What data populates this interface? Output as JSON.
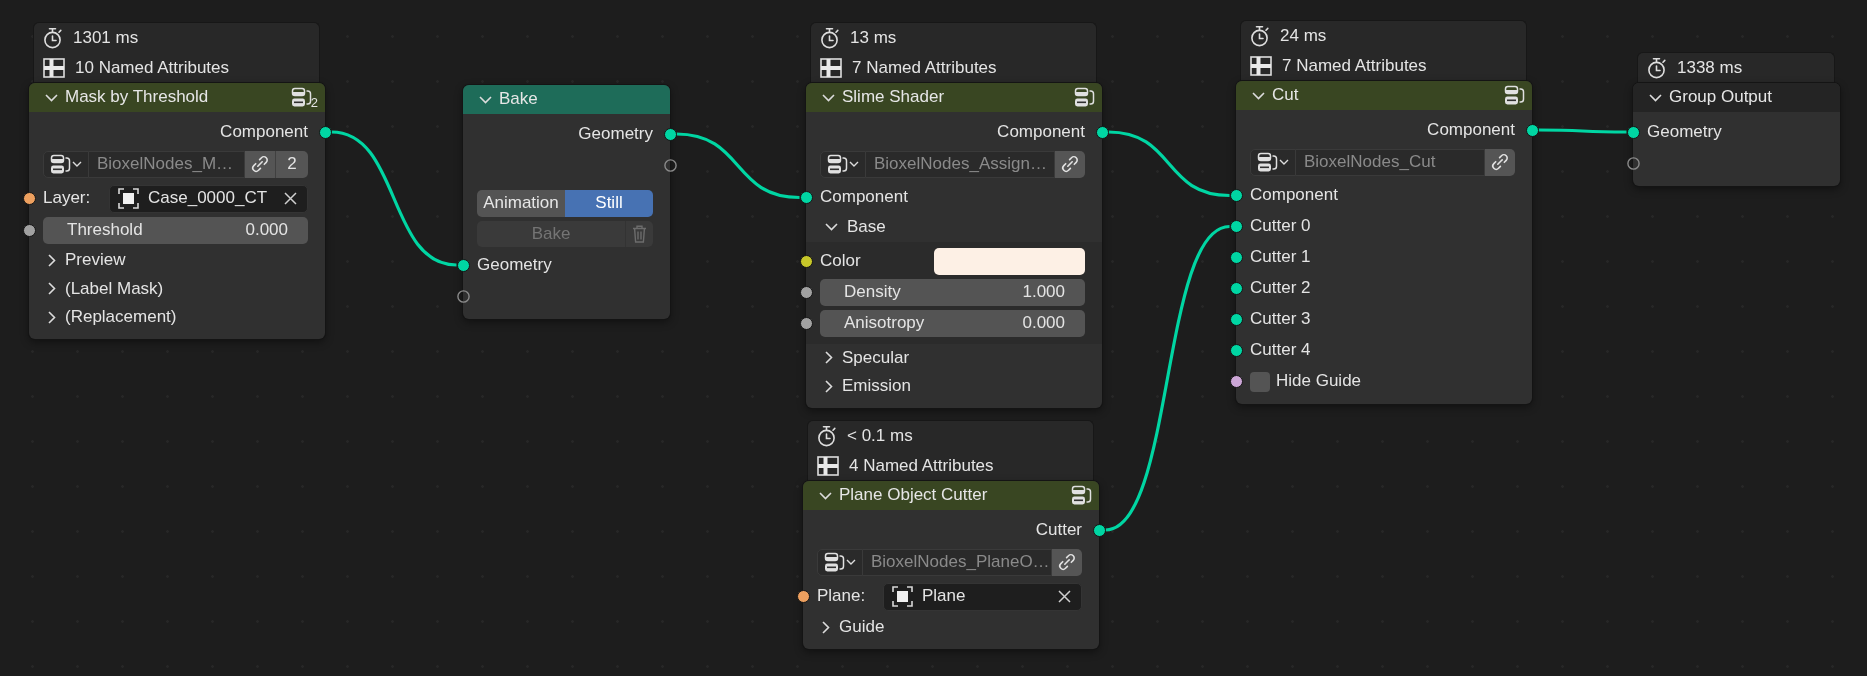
{
  "nodes": [
    {
      "kind": "group",
      "title": "Mask by Threshold",
      "users": "2",
      "info": [
        {
          "kind": "time",
          "text": "1301 ms"
        },
        {
          "kind": "attributes",
          "text": "10 Named Attributes"
        }
      ],
      "rows": [
        {
          "kind": "output",
          "label": "Component",
          "color": "#00d6a3",
          "linked": true
        },
        {
          "kind": "datablock",
          "value": "BioxelNodes_M…",
          "users": "2"
        },
        {
          "kind": "object",
          "label": "Layer:",
          "value": "Case_0000_CT",
          "color": "#eda05f",
          "linked": false
        },
        {
          "kind": "value",
          "label": "Threshold",
          "value": "0.000",
          "color": "#a1a1a1",
          "linked": false
        },
        {
          "kind": "panel",
          "label": "Preview",
          "expanded": false
        },
        {
          "kind": "panel",
          "label": "(Label Mask)",
          "expanded": false
        },
        {
          "kind": "panel",
          "label": "(Replacement)",
          "expanded": false
        }
      ]
    },
    {
      "kind": "bake",
      "title": "Bake",
      "rows": [
        {
          "kind": "output",
          "label": "Geometry",
          "color": "#00d6a3",
          "linked": true
        },
        {
          "kind": "empty_output"
        },
        {
          "kind": "toggle",
          "options": [
            {
              "label": "Animation",
              "selected": false
            },
            {
              "label": "Still",
              "selected": true
            }
          ]
        },
        {
          "kind": "button",
          "label": "Bake",
          "disabled": true
        },
        {
          "kind": "input",
          "label": "Geometry",
          "color": "#00d6a3",
          "linked": true
        },
        {
          "kind": "empty_input"
        }
      ]
    },
    {
      "kind": "group",
      "title": "Slime Shader",
      "info": [
        {
          "kind": "time",
          "text": "13 ms"
        },
        {
          "kind": "attributes",
          "text": "7 Named Attributes"
        }
      ],
      "rows": [
        {
          "kind": "output",
          "label": "Component",
          "color": "#00d6a3",
          "linked": true
        },
        {
          "kind": "datablock",
          "value": "BioxelNodes_Assign…"
        },
        {
          "kind": "input",
          "label": "Component",
          "color": "#00d6a3",
          "linked": true
        },
        {
          "kind": "panel",
          "label": "Base",
          "expanded": true,
          "children": [
            {
              "kind": "color",
              "label": "Color",
              "swatch": {
                "color": "#fdf0e5"
              },
              "color": "#c7c729",
              "linked": false
            },
            {
              "kind": "value",
              "label": "Density",
              "value": "1.000",
              "color": "#a1a1a1",
              "linked": false
            },
            {
              "kind": "value",
              "label": "Anisotropy",
              "value": "0.000",
              "color": "#a1a1a1",
              "linked": false
            }
          ]
        },
        {
          "kind": "panel",
          "label": "Specular",
          "expanded": false
        },
        {
          "kind": "panel",
          "label": "Emission",
          "expanded": false
        }
      ]
    },
    {
      "kind": "group",
      "title": "Plane Object Cutter",
      "info": [
        {
          "kind": "time",
          "text": "< 0.1 ms"
        },
        {
          "kind": "attributes",
          "text": "4 Named Attributes"
        }
      ],
      "rows": [
        {
          "kind": "output",
          "label": "Cutter",
          "color": "#00d6a3",
          "linked": true
        },
        {
          "kind": "datablock",
          "value": "BioxelNodes_PlaneO…"
        },
        {
          "kind": "object",
          "label": "Plane:",
          "value": "Plane",
          "color": "#eda05f",
          "linked": false
        },
        {
          "kind": "panel",
          "label": "Guide",
          "expanded": false
        }
      ]
    },
    {
      "kind": "group",
      "title": "Cut",
      "info": [
        {
          "kind": "time",
          "text": "24 ms"
        },
        {
          "kind": "attributes",
          "text": "7 Named Attributes"
        }
      ],
      "rows": [
        {
          "kind": "output",
          "label": "Component",
          "color": "#00d6a3",
          "linked": true
        },
        {
          "kind": "datablock",
          "value": "BioxelNodes_Cut"
        },
        {
          "kind": "input",
          "label": "Component",
          "color": "#00d6a3",
          "linked": true
        },
        {
          "kind": "input",
          "label": "Cutter 0",
          "color": "#00d6a3",
          "linked": true
        },
        {
          "kind": "input",
          "label": "Cutter 1",
          "color": "#00d6a3",
          "linked": false
        },
        {
          "kind": "input",
          "label": "Cutter 2",
          "color": "#00d6a3",
          "linked": false
        },
        {
          "kind": "input",
          "label": "Cutter 3",
          "color": "#00d6a3",
          "linked": false
        },
        {
          "kind": "input",
          "label": "Cutter 4",
          "color": "#00d6a3",
          "linked": false
        },
        {
          "kind": "checkbox",
          "label": "Hide Guide",
          "checked": false,
          "color": "#cca6d6",
          "linked": false
        }
      ]
    },
    {
      "kind": "output",
      "title": "Group Output",
      "info": [
        {
          "kind": "time",
          "text": "1338 ms"
        }
      ],
      "rows": [
        {
          "kind": "input",
          "label": "Geometry",
          "color": "#00d6a3",
          "linked": true
        },
        {
          "kind": "empty_input"
        }
      ]
    }
  ]
}
